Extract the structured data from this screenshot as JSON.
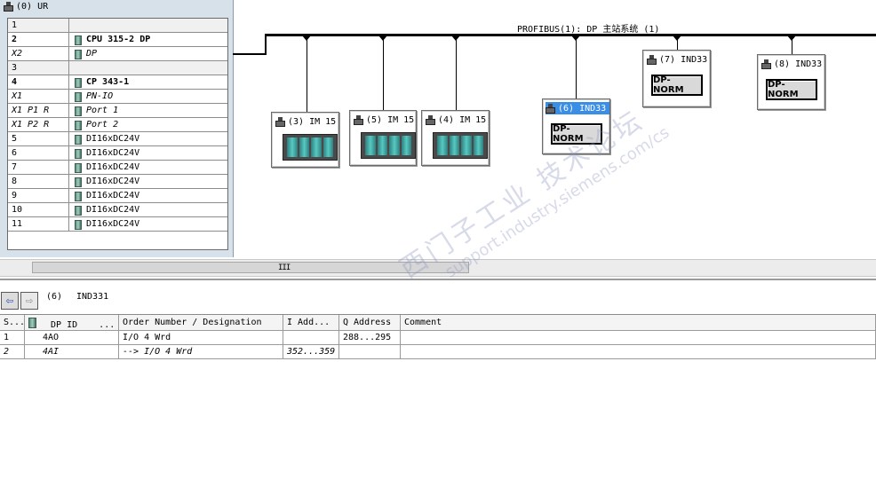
{
  "rack": {
    "title": "(0) UR",
    "rows": [
      {
        "slot": "1",
        "name": "",
        "module": false,
        "bold": false,
        "italic": false
      },
      {
        "slot": "2",
        "name": "CPU 315-2 DP",
        "module": true,
        "bold": true,
        "italic": false
      },
      {
        "slot": "X2",
        "name": "DP",
        "module": true,
        "bold": false,
        "italic": true
      },
      {
        "slot": "3",
        "name": "",
        "module": false,
        "bold": false,
        "italic": false
      },
      {
        "slot": "4",
        "name": "CP 343-1",
        "module": true,
        "bold": true,
        "italic": false
      },
      {
        "slot": "X1",
        "name": "PN-IO",
        "module": true,
        "bold": false,
        "italic": true
      },
      {
        "slot": "X1 P1 R",
        "name": "Port 1",
        "module": true,
        "bold": false,
        "italic": true
      },
      {
        "slot": "X1 P2 R",
        "name": "Port 2",
        "module": true,
        "bold": false,
        "italic": true
      },
      {
        "slot": "5",
        "name": "DI16xDC24V",
        "module": true,
        "bold": false,
        "italic": false
      },
      {
        "slot": "6",
        "name": "DI16xDC24V",
        "module": true,
        "bold": false,
        "italic": false
      },
      {
        "slot": "7",
        "name": "DI16xDC24V",
        "module": true,
        "bold": false,
        "italic": false
      },
      {
        "slot": "8",
        "name": "DI16xDC24V",
        "module": true,
        "bold": false,
        "italic": false
      },
      {
        "slot": "9",
        "name": "DI16xDC24V",
        "module": true,
        "bold": false,
        "italic": false
      },
      {
        "slot": "10",
        "name": "DI16xDC24V",
        "module": true,
        "bold": false,
        "italic": false
      },
      {
        "slot": "11",
        "name": "DI16xDC24V",
        "module": true,
        "bold": false,
        "italic": false
      }
    ]
  },
  "network": {
    "bus_label": "PROFIBUS(1): DP 主站系统 (1)",
    "nodes": [
      {
        "label": "(3) IM 15",
        "type": "im",
        "selected": false
      },
      {
        "label": "(5) IM 15",
        "type": "im",
        "selected": false
      },
      {
        "label": "(4) IM 15",
        "type": "im",
        "selected": false
      },
      {
        "label": "(6) IND33",
        "type": "dp",
        "button": "DP-NORM",
        "selected": true
      },
      {
        "label": "(7) IND33",
        "type": "dp",
        "button": "DP-NORM",
        "selected": false
      },
      {
        "label": "(8) IND33",
        "type": "dp",
        "button": "DP-NORM",
        "selected": false
      }
    ]
  },
  "scrollbar": {
    "grip": "III"
  },
  "detail": {
    "slot": "(6)",
    "name": "IND331",
    "columns": [
      "S...",
      "DP ID",
      "...",
      "Order Number / Designation",
      "I Add...",
      "Q Address",
      "Comment"
    ],
    "rows": [
      {
        "s": "1",
        "dp_id": "4AO",
        "designation": "I/O 4 Wrd",
        "i_addr": "",
        "q_addr": "288...295",
        "comment": "",
        "italic": false
      },
      {
        "s": "2",
        "dp_id": "4AI",
        "designation": "--> I/O 4 Wrd",
        "i_addr": "352...359",
        "q_addr": "",
        "comment": "",
        "italic": true
      }
    ]
  },
  "watermark": {
    "line1": "西门子工业  技术论坛",
    "line2": "support.industry.siemens.com/cs"
  },
  "colors": {
    "selected": "#3a8ee6",
    "module_teal": "#56c9c2",
    "panel_bg": "#d7e1ea"
  }
}
